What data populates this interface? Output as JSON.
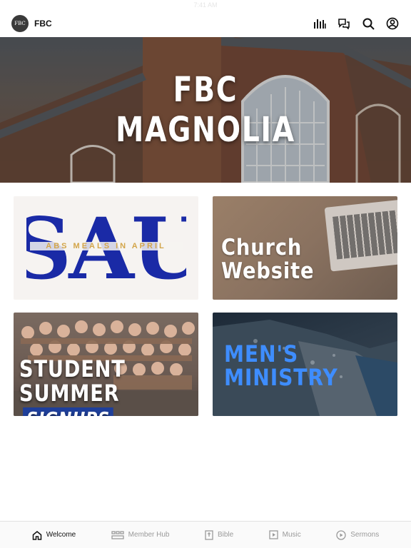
{
  "status_bar": {
    "time": "7:41 AM"
  },
  "header": {
    "app_name": "FBC",
    "logo_text": "FBC",
    "icons": [
      "chart-bars-icon",
      "chat-icon",
      "search-icon",
      "account-icon"
    ]
  },
  "hero": {
    "line1": "FBC",
    "line2": "MAGNOLIA"
  },
  "cards": {
    "sau": {
      "big": "SAU",
      "tagline": "ABS MEALS IN APRIL"
    },
    "church_website": {
      "line1": "Church",
      "line2": "Website"
    },
    "student_summer": {
      "line1": "STUDENT",
      "line2": "SUMMER",
      "signups": "SIGNUPS"
    },
    "mens_ministry": {
      "line1": "MEN'S",
      "line2": "MINISTRY"
    }
  },
  "tabs": [
    {
      "label": "Welcome",
      "icon": "home-icon",
      "active": true
    },
    {
      "label": "Member Hub",
      "icon": "members-icon",
      "active": false
    },
    {
      "label": "Bible",
      "icon": "bible-icon",
      "active": false
    },
    {
      "label": "Music",
      "icon": "music-icon",
      "active": false
    },
    {
      "label": "Sermons",
      "icon": "play-circle-icon",
      "active": false
    }
  ],
  "colors": {
    "sau_blue": "#1a2aa6",
    "sau_gold": "#d3a54a",
    "mens_blue": "#3e8dff",
    "signups_bg": "#1f3f9a"
  }
}
